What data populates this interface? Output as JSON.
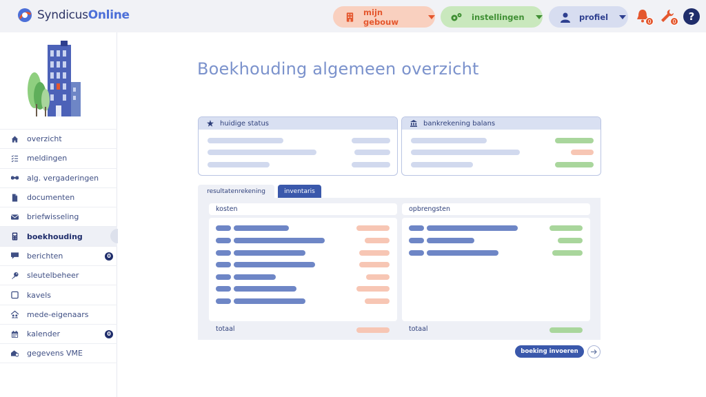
{
  "header": {
    "brand_part1": "Syndicus",
    "brand_part2": "Online",
    "menu_building": "mijn gebouw",
    "menu_settings": "instellingen",
    "menu_profile": "profiel",
    "notifications_count": "0",
    "tools_count": "0",
    "help_label": "?"
  },
  "sidebar": {
    "items": [
      {
        "label": "overzicht",
        "icon": "home-icon"
      },
      {
        "label": "meldingen",
        "icon": "checklist-icon"
      },
      {
        "label": "alg. vergaderingen",
        "icon": "handshake-icon"
      },
      {
        "label": "documenten",
        "icon": "document-icon"
      },
      {
        "label": "briefwisseling",
        "icon": "envelope-icon"
      },
      {
        "label": "boekhouding",
        "icon": "calculator-icon",
        "active": true
      },
      {
        "label": "berichten",
        "icon": "chat-icon",
        "badge": "0"
      },
      {
        "label": "sleutelbeheer",
        "icon": "key-icon"
      },
      {
        "label": "kavels",
        "icon": "square-icon"
      },
      {
        "label": "mede-eigenaars",
        "icon": "people-icon"
      },
      {
        "label": "kalender",
        "icon": "calendar-icon",
        "badge": "0"
      },
      {
        "label": "gegevens VME",
        "icon": "building-settings-icon"
      }
    ]
  },
  "main": {
    "title": "Boekhouding algemeen overzicht",
    "status_card_title": "huidige status",
    "bank_card_title": "bankrekening balans",
    "tabs": [
      "resultatenrekening",
      "inventaris"
    ],
    "costs_header": "kosten",
    "revenue_header": "opbrengsten",
    "costs_total_label": "totaal",
    "revenue_total_label": "totaal",
    "book_button": "boeking invoeren"
  },
  "colors": {
    "accent": "#3a58ab",
    "orange": "#e4572e",
    "green": "#3f8f33",
    "navy": "#1f2d6b"
  }
}
